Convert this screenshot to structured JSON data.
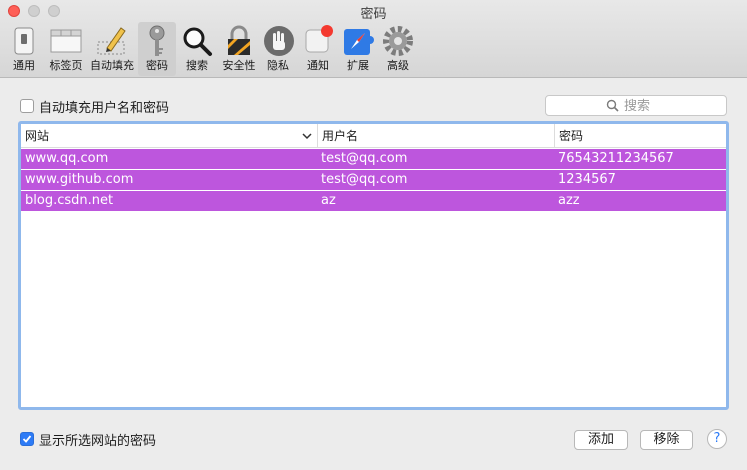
{
  "window": {
    "title": "密码"
  },
  "toolbar": {
    "items": [
      {
        "label": "通用",
        "icon": "general-switch-icon"
      },
      {
        "label": "标签页",
        "icon": "tabs-icon"
      },
      {
        "label": "自动填充",
        "icon": "autofill-pencil-icon"
      },
      {
        "label": "密码",
        "icon": "key-icon",
        "selected": true
      },
      {
        "label": "搜索",
        "icon": "magnifier-icon"
      },
      {
        "label": "安全性",
        "icon": "security-lock-icon"
      },
      {
        "label": "隐私",
        "icon": "privacy-hand-icon"
      },
      {
        "label": "通知",
        "icon": "notification-icon"
      },
      {
        "label": "扩展",
        "icon": "extensions-puzzle-icon"
      },
      {
        "label": "高级",
        "icon": "advanced-gear-icon"
      }
    ]
  },
  "autofill_checkbox": {
    "label": "自动填充用户名和密码",
    "checked": false
  },
  "search": {
    "placeholder": "搜索"
  },
  "table": {
    "columns": [
      "网站",
      "用户名",
      "密码"
    ],
    "rows": [
      {
        "site": "www.qq.com",
        "user": "test@qq.com",
        "password": "76543211234567"
      },
      {
        "site": "www.github.com",
        "user": "test@qq.com",
        "password": "1234567"
      },
      {
        "site": "blog.csdn.net",
        "user": "az",
        "password": "azz"
      }
    ],
    "selected_color": "#bd56dd"
  },
  "show_password_checkbox": {
    "label": "显示所选网站的密码",
    "checked": true
  },
  "buttons": {
    "add": "添加",
    "remove": "移除",
    "help": "?"
  }
}
